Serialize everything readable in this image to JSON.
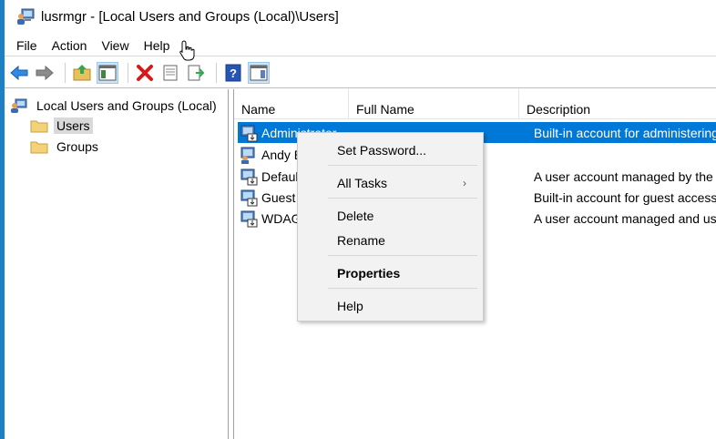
{
  "window": {
    "title": "lusrmgr - [Local Users and Groups (Local)\\Users]",
    "title_icon": "users-computer-icon"
  },
  "menubar": {
    "items": [
      "File",
      "Action",
      "View",
      "Help"
    ]
  },
  "toolbar": {
    "buttons": [
      "back-arrow-icon",
      "forward-arrow-icon",
      "up-folder-icon",
      "show-hide-tree-icon",
      "delete-icon",
      "properties-icon",
      "export-list-icon",
      "help-icon",
      "show-hide-action-pane-icon"
    ]
  },
  "tree": {
    "root": "Local Users and Groups (Local)",
    "children": [
      "Users",
      "Groups"
    ],
    "selected": "Users"
  },
  "list": {
    "columns": [
      "Name",
      "Full Name",
      "Description"
    ],
    "rows": [
      {
        "name": "Administrator",
        "full_name": "",
        "description": "Built-in account for administering"
      },
      {
        "name": "Andy B",
        "full_name": "",
        "description": ""
      },
      {
        "name": "Defaul",
        "full_name": "",
        "description": "A user account managed by the"
      },
      {
        "name": "Guest",
        "full_name": "",
        "description": "Built-in account for guest access"
      },
      {
        "name": "WDAG",
        "full_name": "",
        "description": "A user account managed and use"
      }
    ],
    "selected_row": 0
  },
  "context_menu": {
    "items": [
      "Set Password...",
      "All Tasks",
      "Delete",
      "Rename",
      "Properties",
      "Help"
    ],
    "submenu_arrow": "›",
    "bold_item": "Properties"
  },
  "colors": {
    "selection": "#0078d7",
    "accent_edge": "#1d7fc4",
    "tree_selected": "#d9d9d9",
    "menu_bg": "#f2f2f2"
  }
}
